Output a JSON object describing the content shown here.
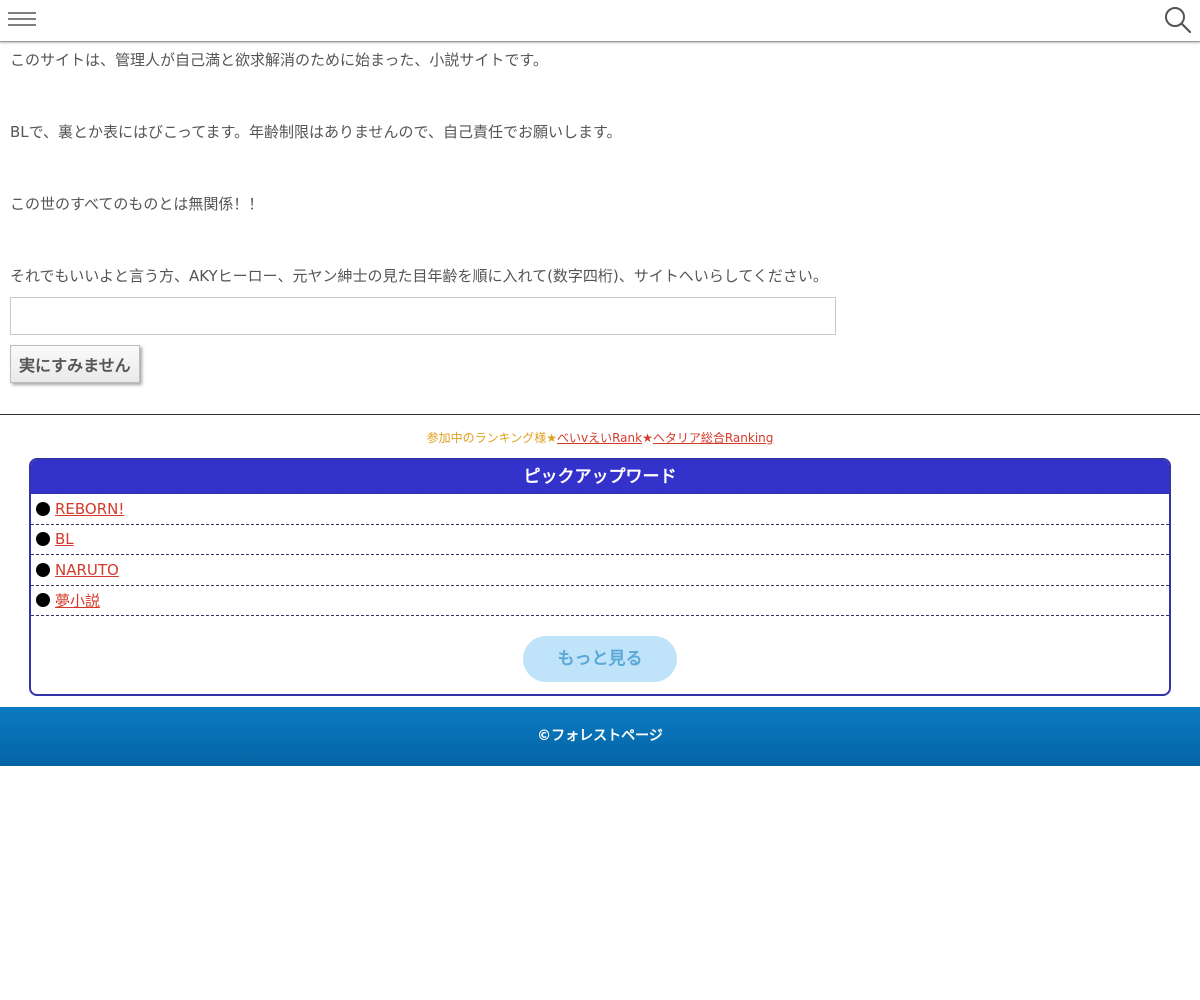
{
  "header": {
    "menu_icon": "hamburger-menu-icon",
    "search_icon": "search-icon"
  },
  "intro": {
    "line1": "このサイトは、管理人が自己満と欲求解消のために始まった、小説サイトです。",
    "line2": "BLで、裏とか表にはびこってます。年齢制限はありませんので、自己責任でお願いします。",
    "line3": "この世のすべてのものとは無関係！！",
    "line4": "それでもいいよと言う方、AKYヒーロー、元ヤン紳士の見た目年齢を順に入れて(数字四桁)、サイトへいらしてください。"
  },
  "form": {
    "input_value": "",
    "submit_label": "実にすみません"
  },
  "ranking": {
    "prefix": "参加中のランキング様★",
    "link1": "べいvえいRank",
    "separator": "★",
    "link2": "ヘタリア総合Ranking"
  },
  "pickup": {
    "title": "ピックアップワード",
    "items": [
      {
        "label": "REBORN!"
      },
      {
        "label": "BL"
      },
      {
        "label": "NARUTO"
      },
      {
        "label": "夢小説"
      }
    ],
    "more_label": "もっと見る"
  },
  "footer": {
    "copyright": "©フォレストページ"
  },
  "colors": {
    "link": "#d43a2a",
    "pickup_header": "#3333cc",
    "more_button_bg": "#bfe3f8",
    "footer_bg": "#0b7ac0"
  }
}
